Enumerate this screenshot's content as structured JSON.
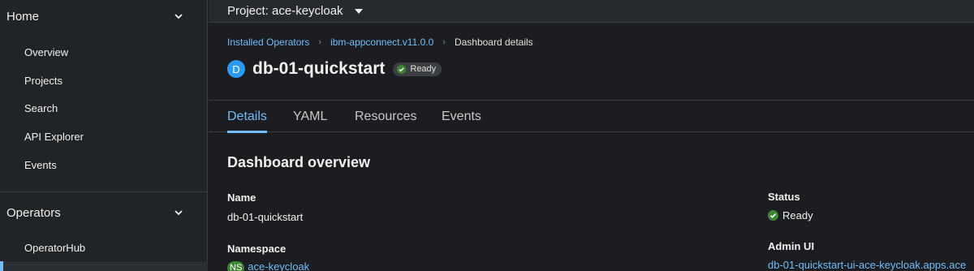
{
  "sidebar": {
    "home_label": "Home",
    "home_items": [
      "Overview",
      "Projects",
      "Search",
      "API Explorer",
      "Events"
    ],
    "operators_label": "Operators",
    "operators_items": [
      "OperatorHub"
    ]
  },
  "project_bar": {
    "label": "Project: ace-keycloak"
  },
  "breadcrumb": {
    "items": [
      "Installed Operators",
      "ibm-appconnect.v11.0.0"
    ],
    "current": "Dashboard details"
  },
  "resource": {
    "badge": "D",
    "name": "db-01-quickstart",
    "status": "Ready"
  },
  "tabs": [
    "Details",
    "YAML",
    "Resources",
    "Events"
  ],
  "details": {
    "section_title": "Dashboard overview",
    "name_label": "Name",
    "name_value": "db-01-quickstart",
    "namespace_label": "Namespace",
    "namespace_badge": "NS",
    "namespace_value": "ace-keycloak",
    "status_label": "Status",
    "status_value": "Ready",
    "admin_ui_label": "Admin UI",
    "admin_ui_value": "db-01-quickstart-ui-ace-keycloak.apps.ace"
  },
  "colors": {
    "link": "#73bcf7",
    "success": "#3e8635",
    "badge_blue": "#2b9af3"
  },
  "icons": {
    "chevron": "chevron-down-icon",
    "caret": "caret-down-icon",
    "breadcrumb_separator": "angle-right-icon",
    "status_ok": "check-circle-icon"
  }
}
